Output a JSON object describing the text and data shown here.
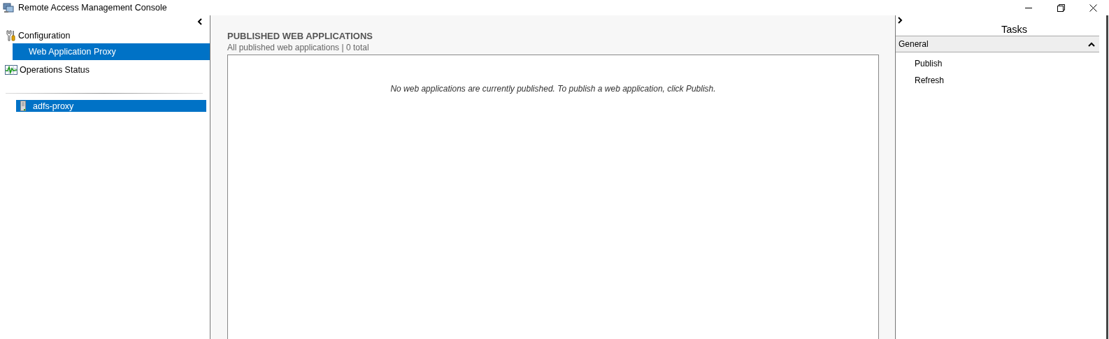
{
  "window": {
    "title": "Remote Access Management Console"
  },
  "navigation": {
    "items": [
      {
        "label": "Configuration",
        "kind": "group",
        "selected": false,
        "children": [
          {
            "label": "Web Application Proxy",
            "selected": true
          }
        ]
      },
      {
        "label": "Operations Status",
        "kind": "status",
        "selected": false
      }
    ]
  },
  "servers": [
    {
      "name": "adfs-proxy",
      "selected": true
    }
  ],
  "content": {
    "heading": "PUBLISHED WEB APPLICATIONS",
    "subtitle": "All published web applications | 0 total",
    "empty_message": "No web applications are currently published. To publish a web application, click Publish."
  },
  "tasks": {
    "title": "Tasks",
    "sections": [
      {
        "title": "General",
        "expanded": true,
        "items": [
          "Publish",
          "Refresh"
        ]
      }
    ]
  }
}
